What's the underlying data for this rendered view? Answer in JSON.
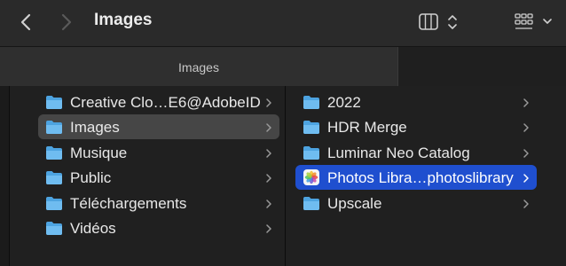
{
  "toolbar": {
    "title": "Images",
    "back_icon": "chevron-left-icon",
    "forward_icon": "chevron-right-icon",
    "view_icon": "column-view-icon",
    "group_icon": "grid-view-icon"
  },
  "tab": {
    "label": "Images"
  },
  "column1": {
    "items": [
      {
        "label": "Creative Clo…E6@AdobeID",
        "icon": "folder-icon"
      },
      {
        "label": "Images",
        "icon": "folder-icon",
        "selected": true
      },
      {
        "label": "Musique",
        "icon": "folder-icon"
      },
      {
        "label": "Public",
        "icon": "folder-icon"
      },
      {
        "label": "Téléchargements",
        "icon": "folder-icon"
      },
      {
        "label": "Vidéos",
        "icon": "folder-icon"
      }
    ]
  },
  "column2": {
    "items": [
      {
        "label": "2022",
        "icon": "folder-icon"
      },
      {
        "label": "HDR Merge",
        "icon": "folder-icon"
      },
      {
        "label": "Luminar Neo Catalog",
        "icon": "folder-icon"
      },
      {
        "label": "Photos Libra…photoslibrary",
        "icon": "photos-library-icon",
        "selected": true
      },
      {
        "label": "Upscale",
        "icon": "folder-icon"
      }
    ]
  },
  "colors": {
    "folder": "#4da3e0",
    "selection_active": "#1f4fcf",
    "selection_inactive": "#464646"
  }
}
